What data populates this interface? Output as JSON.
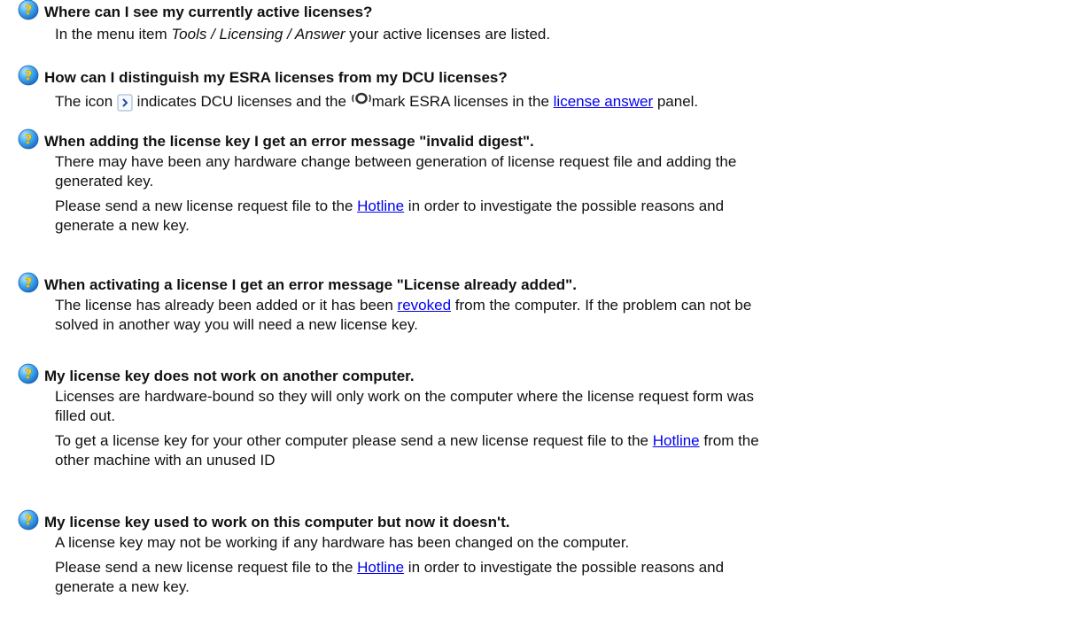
{
  "faq": [
    {
      "question": "Where can I see my currently active licenses?",
      "a1_pre": "In the menu item ",
      "a1_italic": "Tools / Licensing / Answer",
      "a1_post": " your active licenses are listed."
    },
    {
      "question": "How can I distinguish my ESRA licenses from my DCU licenses?",
      "a_pre": "The icon ",
      "a_mid": " indicates DCU licenses and the ",
      "a_mid2": "mark ESRA licenses in the ",
      "a_link": "license answer",
      "a_post": " panel.",
      "icons": [
        "dcu-arrow-icon",
        "esra-ring-icon"
      ]
    },
    {
      "question": "When adding the license key I get an error message \"invalid digest\".",
      "line1": "There may have been any hardware change between generation of license request file and adding the",
      "line2": "generated key.",
      "p2_pre": "Please send a new license request file to the ",
      "p2_link": "Hotline",
      "p2_post": " in order to investigate the possible reasons and",
      "p2_line2": "generate a new key."
    },
    {
      "question": "When activating a license I get an error message \"License already added\".",
      "l1_pre": "The license has already been added or it has been ",
      "l1_link": "revoked",
      "l1_post": " from the computer. If the problem can not be",
      "line2": "solved in another way you will need a new license key."
    },
    {
      "question": "My license key does not work on another computer.",
      "line1": "Licenses are hardware-bound so they will only work on the computer where the license request form was",
      "line2": "filled out.",
      "p2_pre": "To get a license key for your other computer please send a new license request file to the ",
      "p2_link": "Hotline",
      "p2_post": " from the",
      "p2_line2": "other machine with an unused ID"
    },
    {
      "question": "My license key used to work on this computer but now it doesn't.",
      "line1": "A license key may not be working if any hardware has been changed on the computer.",
      "p2_pre": "Please send a new license request file to the ",
      "p2_link": "Hotline",
      "p2_post": " in order to investigate the possible reasons and",
      "p2_line2": "generate a new key."
    }
  ],
  "icon": "question-mark-icon",
  "colors": {
    "icon_blue": "#2b8fe0",
    "link": "#0000ee"
  }
}
